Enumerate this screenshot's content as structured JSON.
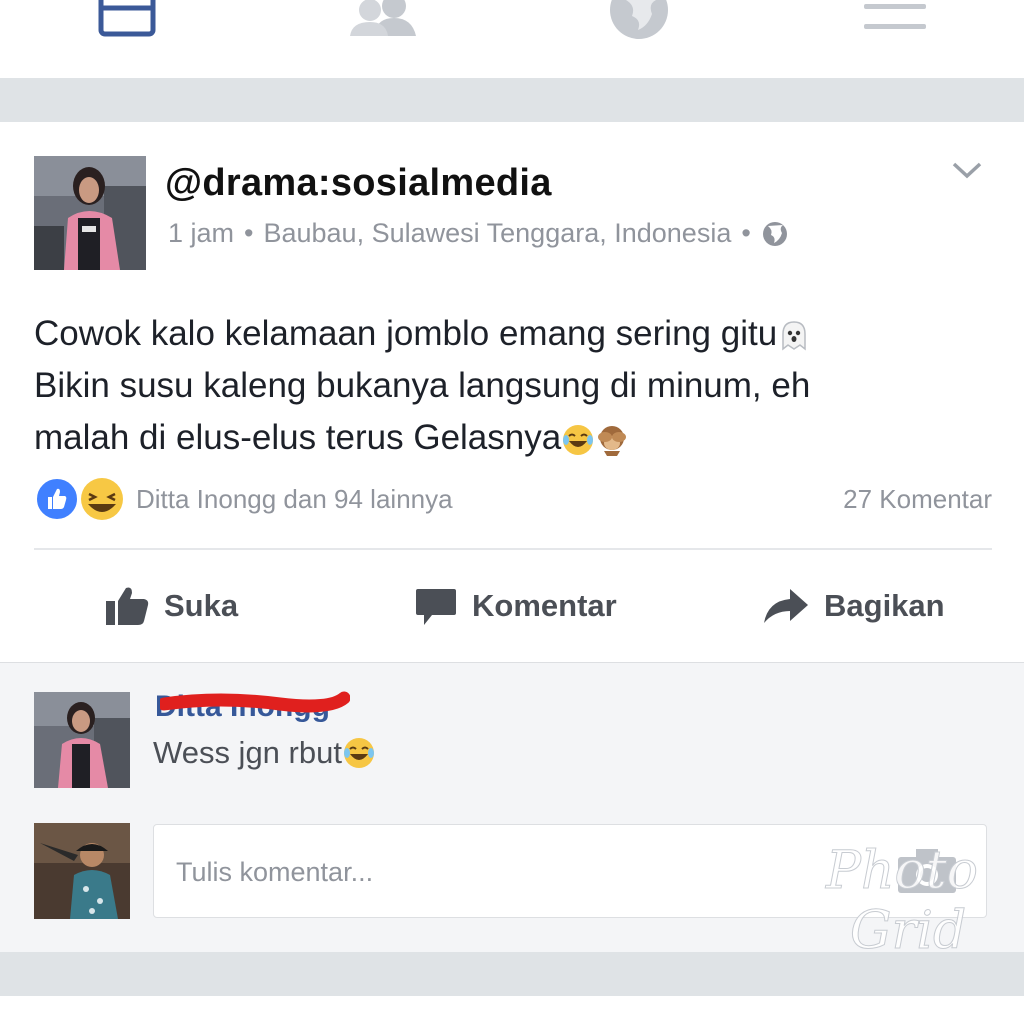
{
  "nav": {
    "icons": [
      "news-feed-icon",
      "friends-icon",
      "globe-icon",
      "menu-icon"
    ]
  },
  "post": {
    "author": "@drama:sosialmedia",
    "time": "1 jam",
    "location": "Baubau, Sulawesi Tenggara, Indonesia",
    "lines": [
      "Cowok kalo kelamaan jomblo emang sering gitu",
      "Bikin susu kaleng bukanya langsung di minum, eh",
      "malah di elus-elus terus Gelasnya"
    ],
    "reactions_text": "Ditta Inongg dan 94 lainnya",
    "comment_count": "27 Komentar"
  },
  "actions": {
    "like": "Suka",
    "comment": "Komentar",
    "share": "Bagikan"
  },
  "comment": {
    "author": "Ditta Inongg",
    "text": "Wess jgn rbut"
  },
  "composer": {
    "placeholder": "Tulis komentar..."
  },
  "watermark": {
    "line1": "Photo",
    "line2": "Grid"
  },
  "colors": {
    "brand": "#3b5998",
    "like_blue": "#4080ff",
    "redaction": "#e0201e",
    "text": "#1d2129",
    "muted": "#90949c"
  }
}
